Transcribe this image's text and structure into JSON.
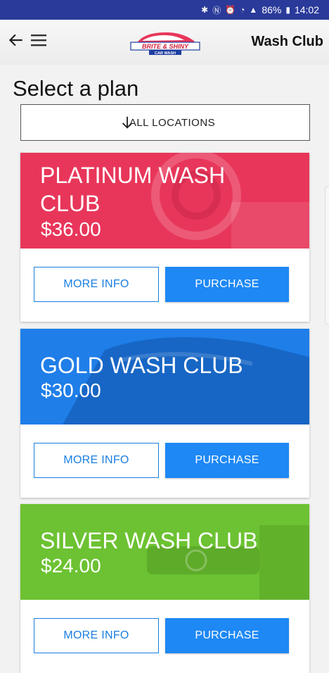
{
  "status_bar": {
    "battery": "86%",
    "time": "14:02"
  },
  "app_bar": {
    "title": "Wash Club",
    "logo_text": "BRITE & SHINY",
    "logo_sub": "CAR WASH"
  },
  "page": {
    "heading": "Select a plan",
    "location_button": "ALL LOCATIONS"
  },
  "plans": [
    {
      "name": "PLATINUM WASH CLUB",
      "price": "$36.00",
      "color": "#e8365a",
      "more_info": "MORE INFO",
      "purchase": "PURCHASE"
    },
    {
      "name": "GOLD WASH CLUB",
      "price": "$30.00",
      "color": "#1f7ee8",
      "more_info": "MORE INFO",
      "purchase": "PURCHASE"
    },
    {
      "name": "SILVER WASH CLUB",
      "price": "$24.00",
      "color": "#6cc232",
      "more_info": "MORE INFO",
      "purchase": "PURCHASE"
    }
  ],
  "colors": {
    "status_bar": "#2a3a9a",
    "accent": "#1e88f5"
  }
}
